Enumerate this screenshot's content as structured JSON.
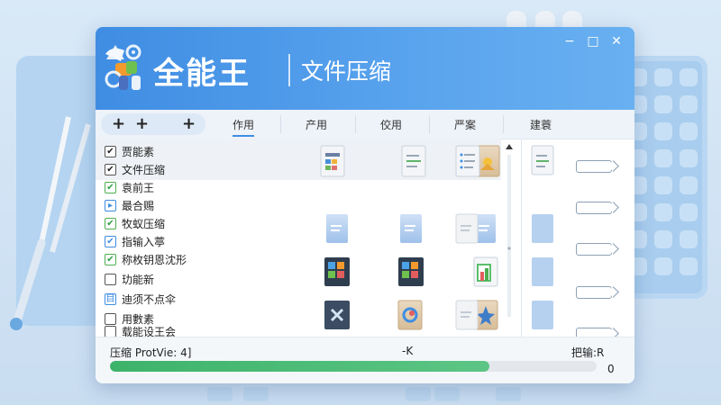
{
  "window": {
    "brand": "全能王",
    "subtitle": "文件压缩",
    "controls": {
      "minimize": "−",
      "maximize": "□",
      "close": "✕"
    }
  },
  "toolbar": {
    "pill_buttons": [
      "+",
      "+",
      "+"
    ],
    "tabs": [
      "作用",
      "产用",
      "佼用",
      "严案",
      "建蓑"
    ],
    "active_tab": 0
  },
  "sidebar": {
    "items": [
      {
        "label": "贾能素",
        "check": "✔",
        "style": "plain"
      },
      {
        "label": "文件压缩",
        "check": "✔",
        "style": "plain"
      },
      {
        "label": "袁前王",
        "check": "✔",
        "style": "green"
      },
      {
        "label": "最合赐",
        "check": "▸",
        "style": "blue"
      },
      {
        "label": "牧蚁压缩",
        "check": "✔",
        "style": "green"
      },
      {
        "label": "指输入葶",
        "check": "✔",
        "style": "blue"
      },
      {
        "label": "称枚钥恩沈形",
        "check": "✔",
        "style": "green"
      },
      {
        "label": "玏能新",
        "check": "",
        "style": "plain"
      },
      {
        "label": "迪须不点伞",
        "check": "目",
        "style": "blue"
      },
      {
        "label": "用數素",
        "check": "",
        "style": "plain"
      },
      {
        "label": "载能设王会",
        "check": "",
        "style": "plain"
      }
    ]
  },
  "status": {
    "left": "压缩 ProtVie: 4]",
    "middle": "-K",
    "right": "把输:R",
    "progress": 0.78,
    "progress_value": "0"
  },
  "colors": {
    "accent": "#3f8de3",
    "progress": "#3db36a"
  }
}
